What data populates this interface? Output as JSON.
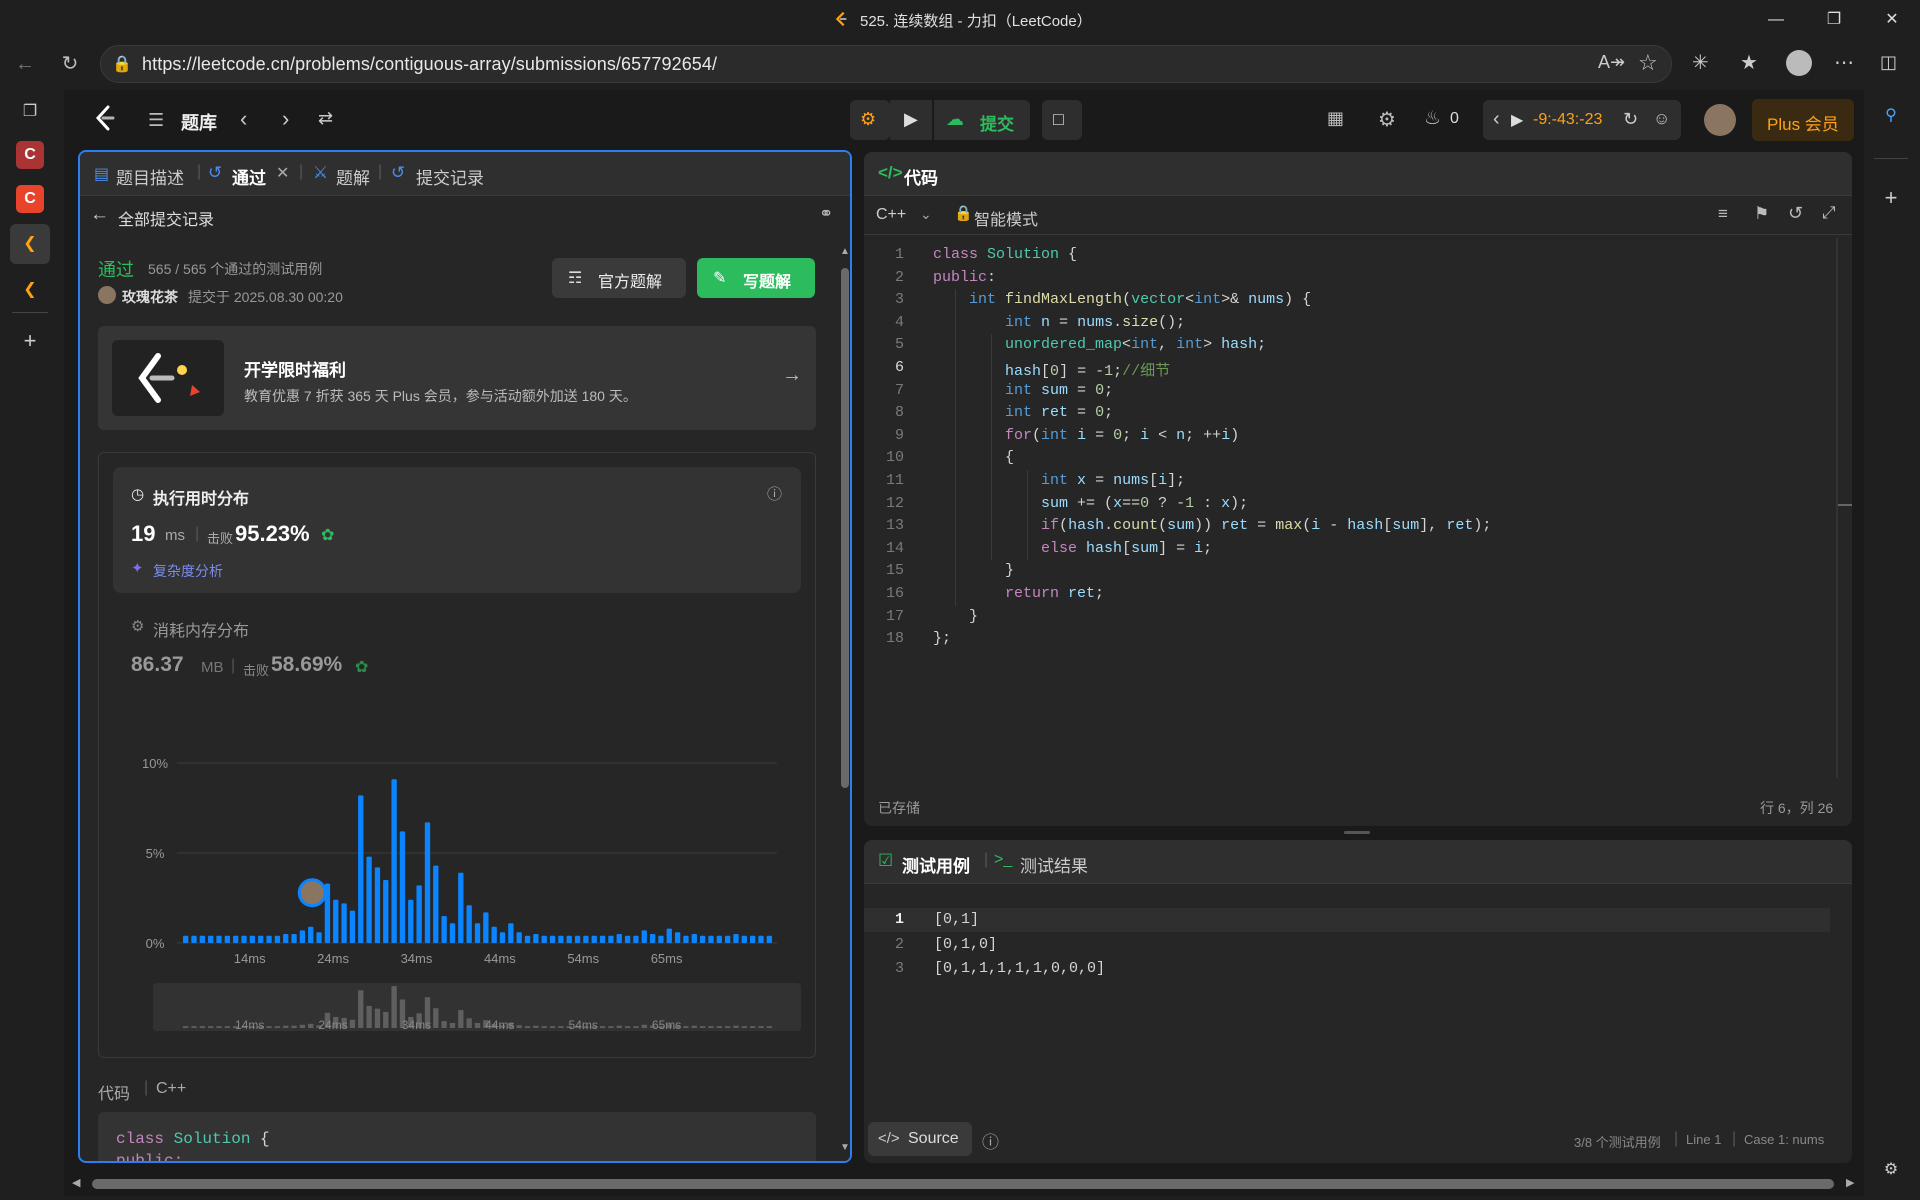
{
  "window": {
    "title": "525. 连续数组 - 力扣（LeetCode）"
  },
  "browser": {
    "url": "https://leetcode.cn/problems/contiguous-array/submissions/657792654/"
  },
  "topnav": {
    "problem_list": "题库",
    "submit": "提交",
    "fire_count": "0",
    "timer": "-9:-43:-23",
    "plus": "Plus 会员"
  },
  "left_tabs": [
    {
      "label": "题目描述"
    },
    {
      "label": "通过"
    },
    {
      "label": "题解"
    },
    {
      "label": "提交记录"
    }
  ],
  "submission": {
    "back_label": "全部提交记录",
    "status": "通过",
    "testcases": "565 / 565 个通过的测试用例",
    "user": "玫瑰花茶",
    "submitted_at": "提交于 2025.08.30 00:20",
    "official_btn": "官方题解",
    "write_btn": "写题解",
    "promo": {
      "title": "开学限时福利",
      "desc": "教育优惠 7 折获 365 天 Plus 会员，参与活动额外加送 180 天。"
    },
    "runtime": {
      "title": "执行用时分布",
      "value": "19",
      "unit": "ms",
      "beat_label": "击败",
      "beat": "95.23%",
      "complexity": "复杂度分析"
    },
    "memory": {
      "title": "消耗内存分布",
      "value": "86.37",
      "unit": "MB",
      "beat_label": "击败",
      "beat": "58.69%"
    },
    "code_label": "代码",
    "lang_label": "C++",
    "code_preview": [
      "class Solution {",
      "public:"
    ]
  },
  "chart_data": {
    "type": "bar",
    "title": "执行用时分布",
    "ylabel": "",
    "ylim": [
      0,
      10
    ],
    "yticks": [
      "10%",
      "5%",
      "0%"
    ],
    "xticks": [
      "14ms",
      "24ms",
      "34ms",
      "44ms",
      "54ms",
      "65ms"
    ],
    "highlight_index": 15,
    "values": [
      0.4,
      0.4,
      0.4,
      0.4,
      0.4,
      0.4,
      0.4,
      0.4,
      0.4,
      0.4,
      0.4,
      0.4,
      0.5,
      0.5,
      0.7,
      0.9,
      0.6,
      3.3,
      2.4,
      2.2,
      1.8,
      8.2,
      4.8,
      4.2,
      3.5,
      9.1,
      6.2,
      2.4,
      3.2,
      6.7,
      4.3,
      1.5,
      1.1,
      3.9,
      2.1,
      1.1,
      1.7,
      0.9,
      0.6,
      1.1,
      0.6,
      0.4,
      0.5,
      0.4,
      0.4,
      0.4,
      0.4,
      0.4,
      0.4,
      0.4,
      0.4,
      0.4,
      0.5,
      0.4,
      0.4,
      0.7,
      0.5,
      0.4,
      0.8,
      0.6,
      0.4,
      0.5,
      0.4,
      0.4,
      0.4,
      0.4,
      0.5,
      0.4,
      0.4,
      0.4,
      0.4
    ]
  },
  "editor": {
    "tab_label": "代码",
    "language": "C++",
    "mode": "智能模式",
    "saved": "已存储",
    "cursor": "行 6，列 26",
    "lines": [
      [
        [
          "kw",
          "class "
        ],
        [
          "cl",
          "Solution"
        ],
        [
          "tx",
          " {"
        ]
      ],
      [
        [
          "kw",
          "public"
        ],
        [
          "tx",
          ":"
        ]
      ],
      [
        [
          "tx",
          "    "
        ],
        [
          "ty",
          "int "
        ],
        [
          "fn",
          "findMaxLength"
        ],
        [
          "tx",
          "("
        ],
        [
          "cl",
          "vector"
        ],
        [
          "tx",
          "<"
        ],
        [
          "ty",
          "int"
        ],
        [
          "tx",
          ">& "
        ],
        [
          "vr",
          "nums"
        ],
        [
          "tx",
          ") {"
        ]
      ],
      [
        [
          "tx",
          "        "
        ],
        [
          "ty",
          "int "
        ],
        [
          "vr",
          "n"
        ],
        [
          "tx",
          " = "
        ],
        [
          "vr",
          "nums"
        ],
        [
          "tx",
          "."
        ],
        [
          "fn",
          "size"
        ],
        [
          "tx",
          "();"
        ]
      ],
      [
        [
          "tx",
          "        "
        ],
        [
          "cl",
          "unordered_map"
        ],
        [
          "tx",
          "<"
        ],
        [
          "ty",
          "int"
        ],
        [
          "tx",
          ", "
        ],
        [
          "ty",
          "int"
        ],
        [
          "tx",
          "> "
        ],
        [
          "vr",
          "hash"
        ],
        [
          "tx",
          ";"
        ]
      ],
      [
        [
          "tx",
          "        "
        ],
        [
          "vr",
          "hash"
        ],
        [
          "tx",
          "["
        ],
        [
          "nm",
          "0"
        ],
        [
          "tx",
          "] = -"
        ],
        [
          "nm",
          "1"
        ],
        [
          "tx",
          ";"
        ],
        [
          "cm",
          "//细节"
        ]
      ],
      [
        [
          "tx",
          "        "
        ],
        [
          "ty",
          "int "
        ],
        [
          "vr",
          "sum"
        ],
        [
          "tx",
          " = "
        ],
        [
          "nm",
          "0"
        ],
        [
          "tx",
          ";"
        ]
      ],
      [
        [
          "tx",
          "        "
        ],
        [
          "ty",
          "int "
        ],
        [
          "vr",
          "ret"
        ],
        [
          "tx",
          " = "
        ],
        [
          "nm",
          "0"
        ],
        [
          "tx",
          ";"
        ]
      ],
      [
        [
          "tx",
          "        "
        ],
        [
          "kw",
          "for"
        ],
        [
          "tx",
          "("
        ],
        [
          "ty",
          "int "
        ],
        [
          "vr",
          "i"
        ],
        [
          "tx",
          " = "
        ],
        [
          "nm",
          "0"
        ],
        [
          "tx",
          "; "
        ],
        [
          "vr",
          "i"
        ],
        [
          "tx",
          " < "
        ],
        [
          "vr",
          "n"
        ],
        [
          "tx",
          "; ++"
        ],
        [
          "vr",
          "i"
        ],
        [
          "tx",
          ")"
        ]
      ],
      [
        [
          "tx",
          "        {"
        ]
      ],
      [
        [
          "tx",
          "            "
        ],
        [
          "ty",
          "int "
        ],
        [
          "vr",
          "x"
        ],
        [
          "tx",
          " = "
        ],
        [
          "vr",
          "nums"
        ],
        [
          "tx",
          "["
        ],
        [
          "vr",
          "i"
        ],
        [
          "tx",
          "];"
        ]
      ],
      [
        [
          "tx",
          "            "
        ],
        [
          "vr",
          "sum"
        ],
        [
          "tx",
          " += ("
        ],
        [
          "vr",
          "x"
        ],
        [
          "tx",
          "=="
        ],
        [
          "nm",
          "0"
        ],
        [
          "tx",
          " ? -"
        ],
        [
          "nm",
          "1"
        ],
        [
          "tx",
          " : "
        ],
        [
          "vr",
          "x"
        ],
        [
          "tx",
          ");"
        ]
      ],
      [
        [
          "tx",
          "            "
        ],
        [
          "kw",
          "if"
        ],
        [
          "tx",
          "("
        ],
        [
          "vr",
          "hash"
        ],
        [
          "tx",
          "."
        ],
        [
          "fn",
          "count"
        ],
        [
          "tx",
          "("
        ],
        [
          "vr",
          "sum"
        ],
        [
          "tx",
          ")) "
        ],
        [
          "vr",
          "ret"
        ],
        [
          "tx",
          " = "
        ],
        [
          "fn",
          "max"
        ],
        [
          "tx",
          "("
        ],
        [
          "vr",
          "i"
        ],
        [
          "tx",
          " - "
        ],
        [
          "vr",
          "hash"
        ],
        [
          "tx",
          "["
        ],
        [
          "vr",
          "sum"
        ],
        [
          "tx",
          "], "
        ],
        [
          "vr",
          "ret"
        ],
        [
          "tx",
          ");"
        ]
      ],
      [
        [
          "tx",
          "            "
        ],
        [
          "kw",
          "else "
        ],
        [
          "vr",
          "hash"
        ],
        [
          "tx",
          "["
        ],
        [
          "vr",
          "sum"
        ],
        [
          "tx",
          "] = "
        ],
        [
          "vr",
          "i"
        ],
        [
          "tx",
          ";"
        ]
      ],
      [
        [
          "tx",
          "        }"
        ]
      ],
      [
        [
          "tx",
          "        "
        ],
        [
          "kw",
          "return "
        ],
        [
          "vr",
          "ret"
        ],
        [
          "tx",
          ";"
        ]
      ],
      [
        [
          "tx",
          "    }"
        ]
      ],
      [
        [
          "tx",
          "};"
        ]
      ]
    ]
  },
  "testpanel": {
    "tab_cases": "测试用例",
    "tab_result": "测试结果",
    "cases": [
      "[0,1]",
      "[0,1,0]",
      "[0,1,1,1,1,1,0,0,0]"
    ],
    "source_btn": "Source",
    "status_count": "3/8 个测试用例",
    "status_line": "Line 1",
    "status_case": "Case 1: nums"
  },
  "colors": {
    "accent": "#2d7ef0",
    "success": "#2cbb5d",
    "bar": "#0a84ff",
    "orange": "#ffa116"
  }
}
